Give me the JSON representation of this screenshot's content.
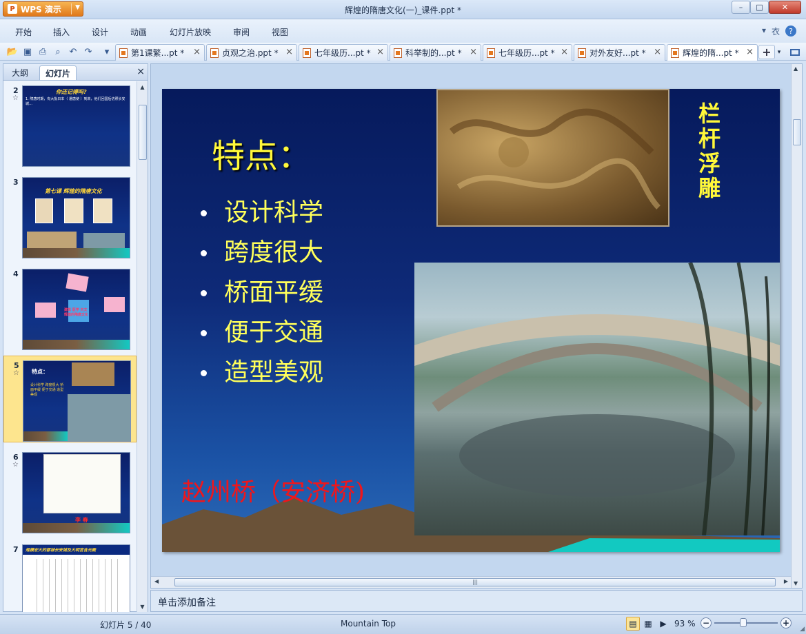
{
  "app": {
    "name": "WPS 演示",
    "logo_glyph": "P",
    "window_title": "辉煌的隋唐文化(一)_课件.ppt *"
  },
  "window_controls": {
    "minimize": "–",
    "maximize": "□",
    "close": "✕"
  },
  "menu": {
    "items": [
      "开始",
      "插入",
      "设计",
      "动画",
      "幻灯片放映",
      "审阅",
      "视图"
    ],
    "right": {
      "dropdown": "▾",
      "shirt": "衣",
      "help": "?"
    }
  },
  "quick_access": [
    "folder-icon",
    "save-icon",
    "print-icon",
    "print-preview-icon",
    "undo-icon",
    "redo-icon",
    "customize-icon"
  ],
  "doc_tabs": [
    {
      "label": "第1课繁...pt *",
      "active": false
    },
    {
      "label": "贞观之治.ppt *",
      "active": false
    },
    {
      "label": "七年级历...pt *",
      "active": false
    },
    {
      "label": "科举制的...pt *",
      "active": false
    },
    {
      "label": "七年级历...pt *",
      "active": false
    },
    {
      "label": "对外友好...pt *",
      "active": false
    },
    {
      "label": "辉煌的隋...pt *",
      "active": true
    }
  ],
  "left_panel": {
    "tabs": {
      "outline": "大纲",
      "slides": "幻灯片"
    },
    "close": "×",
    "thumbnails": [
      {
        "num": "2",
        "title": "你还记得吗?",
        "lines": "1. 隋唐时期，有大批日本（ 遣唐使 ）到来，他们回国后仿照长安城…",
        "selected": false,
        "starred": true
      },
      {
        "num": "3",
        "title": "第七课  辉煌的隋唐文化",
        "lines": "",
        "selected": false,
        "starred": false
      },
      {
        "num": "4",
        "title": "",
        "lines": "建筑 医学 天文 辉煌的隋唐文化",
        "selected": false,
        "starred": false
      },
      {
        "num": "5",
        "title": "特点：",
        "lines": "设计科学 跨度很大 桥面平缓 便于交通 造型美观",
        "selected": true,
        "starred": true
      },
      {
        "num": "6",
        "title": "",
        "lines": "李 春",
        "selected": false,
        "starred": true
      },
      {
        "num": "7",
        "title": "规模宏大的都城长安城及大明宫含元殿",
        "lines": "",
        "selected": false,
        "starred": false
      }
    ]
  },
  "slide": {
    "title": "特点：",
    "bullets": [
      "设计科学",
      "跨度很大",
      "桥面平缓",
      "便于交通",
      "造型美观"
    ],
    "vertical_caption": [
      "栏",
      "杆",
      "浮",
      "雕"
    ],
    "subtitle": "赵州桥（安济桥)",
    "photos": {
      "carving": "stone relief carving photo",
      "bridge": "Zhaozhou arch bridge photo"
    }
  },
  "notes": {
    "placeholder": "单击添加备注"
  },
  "status": {
    "slide_info": "幻灯片 5 / 40",
    "theme": "Mountain Top",
    "zoom": "93 %",
    "zoom_fraction": 0.46
  },
  "colors": {
    "accent": "#e0781b",
    "slide_title": "#fff83a",
    "subtitle_red": "#f0161b"
  }
}
